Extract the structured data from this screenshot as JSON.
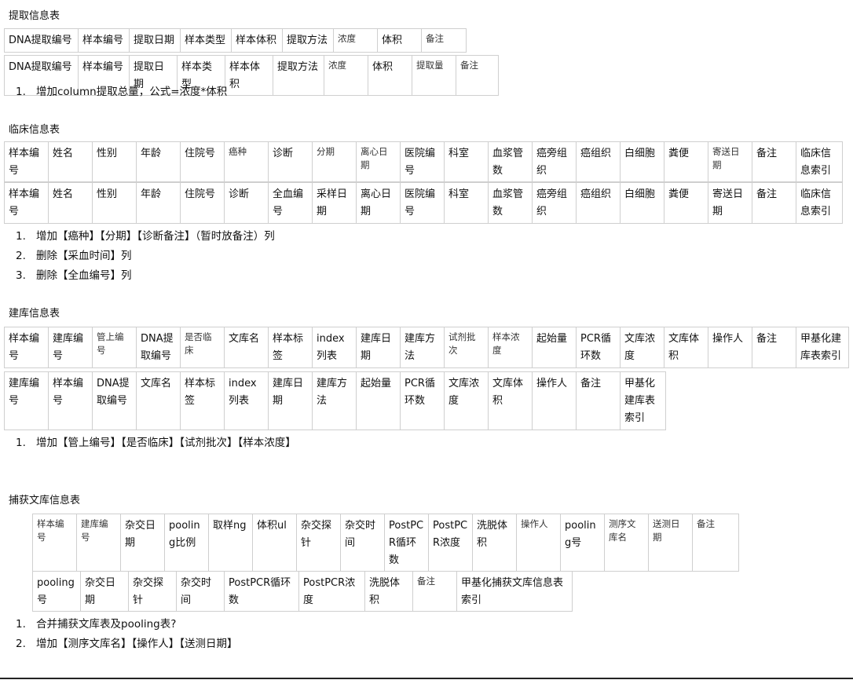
{
  "sections": [
    {
      "title": "提取信息表",
      "tables": [
        {
          "cells": [
            "DNA提取编号",
            "样本编号",
            "提取日期",
            "样本类型",
            "样本体积",
            "提取方法",
            "浓度",
            "体积",
            "备注"
          ]
        },
        {
          "cells": [
            "DNA提取编号",
            "样本编号",
            "提取日期",
            "样本类型",
            "样本体积",
            "提取方法",
            "浓度",
            "体积",
            "提取量",
            "备注"
          ]
        }
      ],
      "notes": [
        {
          "num": "1.",
          "text": "增加column提取总量，公式=浓度*体积"
        }
      ]
    },
    {
      "title": "临床信息表",
      "tables": [
        {
          "cells": [
            "样本编号",
            "姓名",
            "性别",
            "年龄",
            "住院号",
            "癌种",
            "诊断",
            "分期",
            "离心日期",
            "医院编号",
            "科室",
            "血浆管数",
            "癌旁组织",
            "癌组织",
            "白细胞",
            "粪便",
            "寄送日期",
            "备注",
            "临床信息索引"
          ]
        },
        {
          "cells": [
            "样本编号",
            "姓名",
            "性别",
            "年龄",
            "住院号",
            "诊断",
            "全血编号",
            "采样日期",
            "离心日期",
            "医院编号",
            "科室",
            "血浆管数",
            "癌旁组织",
            "癌组织",
            "白细胞",
            "粪便",
            "寄送日期",
            "备注",
            "临床信息索引"
          ]
        }
      ],
      "notes": [
        {
          "num": "1.",
          "text": "增加【癌种】【分期】【诊断备注】（暂时放备注）列"
        },
        {
          "num": "2.",
          "text": "删除【采血时间】列"
        },
        {
          "num": "3.",
          "text": "删除【全血编号】列"
        }
      ]
    },
    {
      "title": "建库信息表",
      "tables": [
        {
          "cells": [
            "样本编号",
            "建库编号",
            "管上编号",
            "DNA提取编号",
            "是否临床",
            "文库名",
            "样本标签",
            "index列表",
            "建库日期",
            "建库方法",
            "试剂批次",
            "样本浓度",
            "起始量",
            "PCR循环数",
            "文库浓度",
            "文库体积",
            "操作人",
            "备注",
            "甲基化建库表索引"
          ]
        },
        {
          "cells": [
            "建库编号",
            "样本编号",
            "DNA提取编号",
            "文库名",
            "样本标签",
            "index列表",
            "建库日期",
            "建库方法",
            "起始量",
            "PCR循环数",
            "文库浓度",
            "文库体积",
            "操作人",
            "备注",
            "甲基化建库表索引"
          ]
        }
      ],
      "notes": [
        {
          "num": "1.",
          "text": "增加【管上编号】【是否临床】【试剂批次】【样本浓度】"
        }
      ]
    },
    {
      "title": "捕获文库信息表",
      "tables": [
        {
          "cells": [
            "样本编号",
            "建库编号",
            "杂交日期",
            "pooling比例",
            "取样ng",
            "体积ul",
            "杂交探针",
            "杂交时间",
            "PostPCR循环数",
            "PostPCR浓度",
            "洗脱体积",
            "操作人",
            "pooling号",
            "测序文库名",
            "送测日期",
            "备注"
          ]
        },
        {
          "cells": [
            "pooling号",
            "杂交日期",
            "杂交探针",
            "杂交时间",
            "PostPCR循环数",
            "PostPCR浓度",
            "洗脱体积",
            "备注",
            "甲基化捕获文库信息表索引"
          ]
        }
      ],
      "notes": [
        {
          "num": "1.",
          "text": "合并捕获文库表及pooling表?"
        },
        {
          "num": "2.",
          "text": "增加【测序文库名】【操作人】【送测日期】"
        }
      ]
    }
  ]
}
